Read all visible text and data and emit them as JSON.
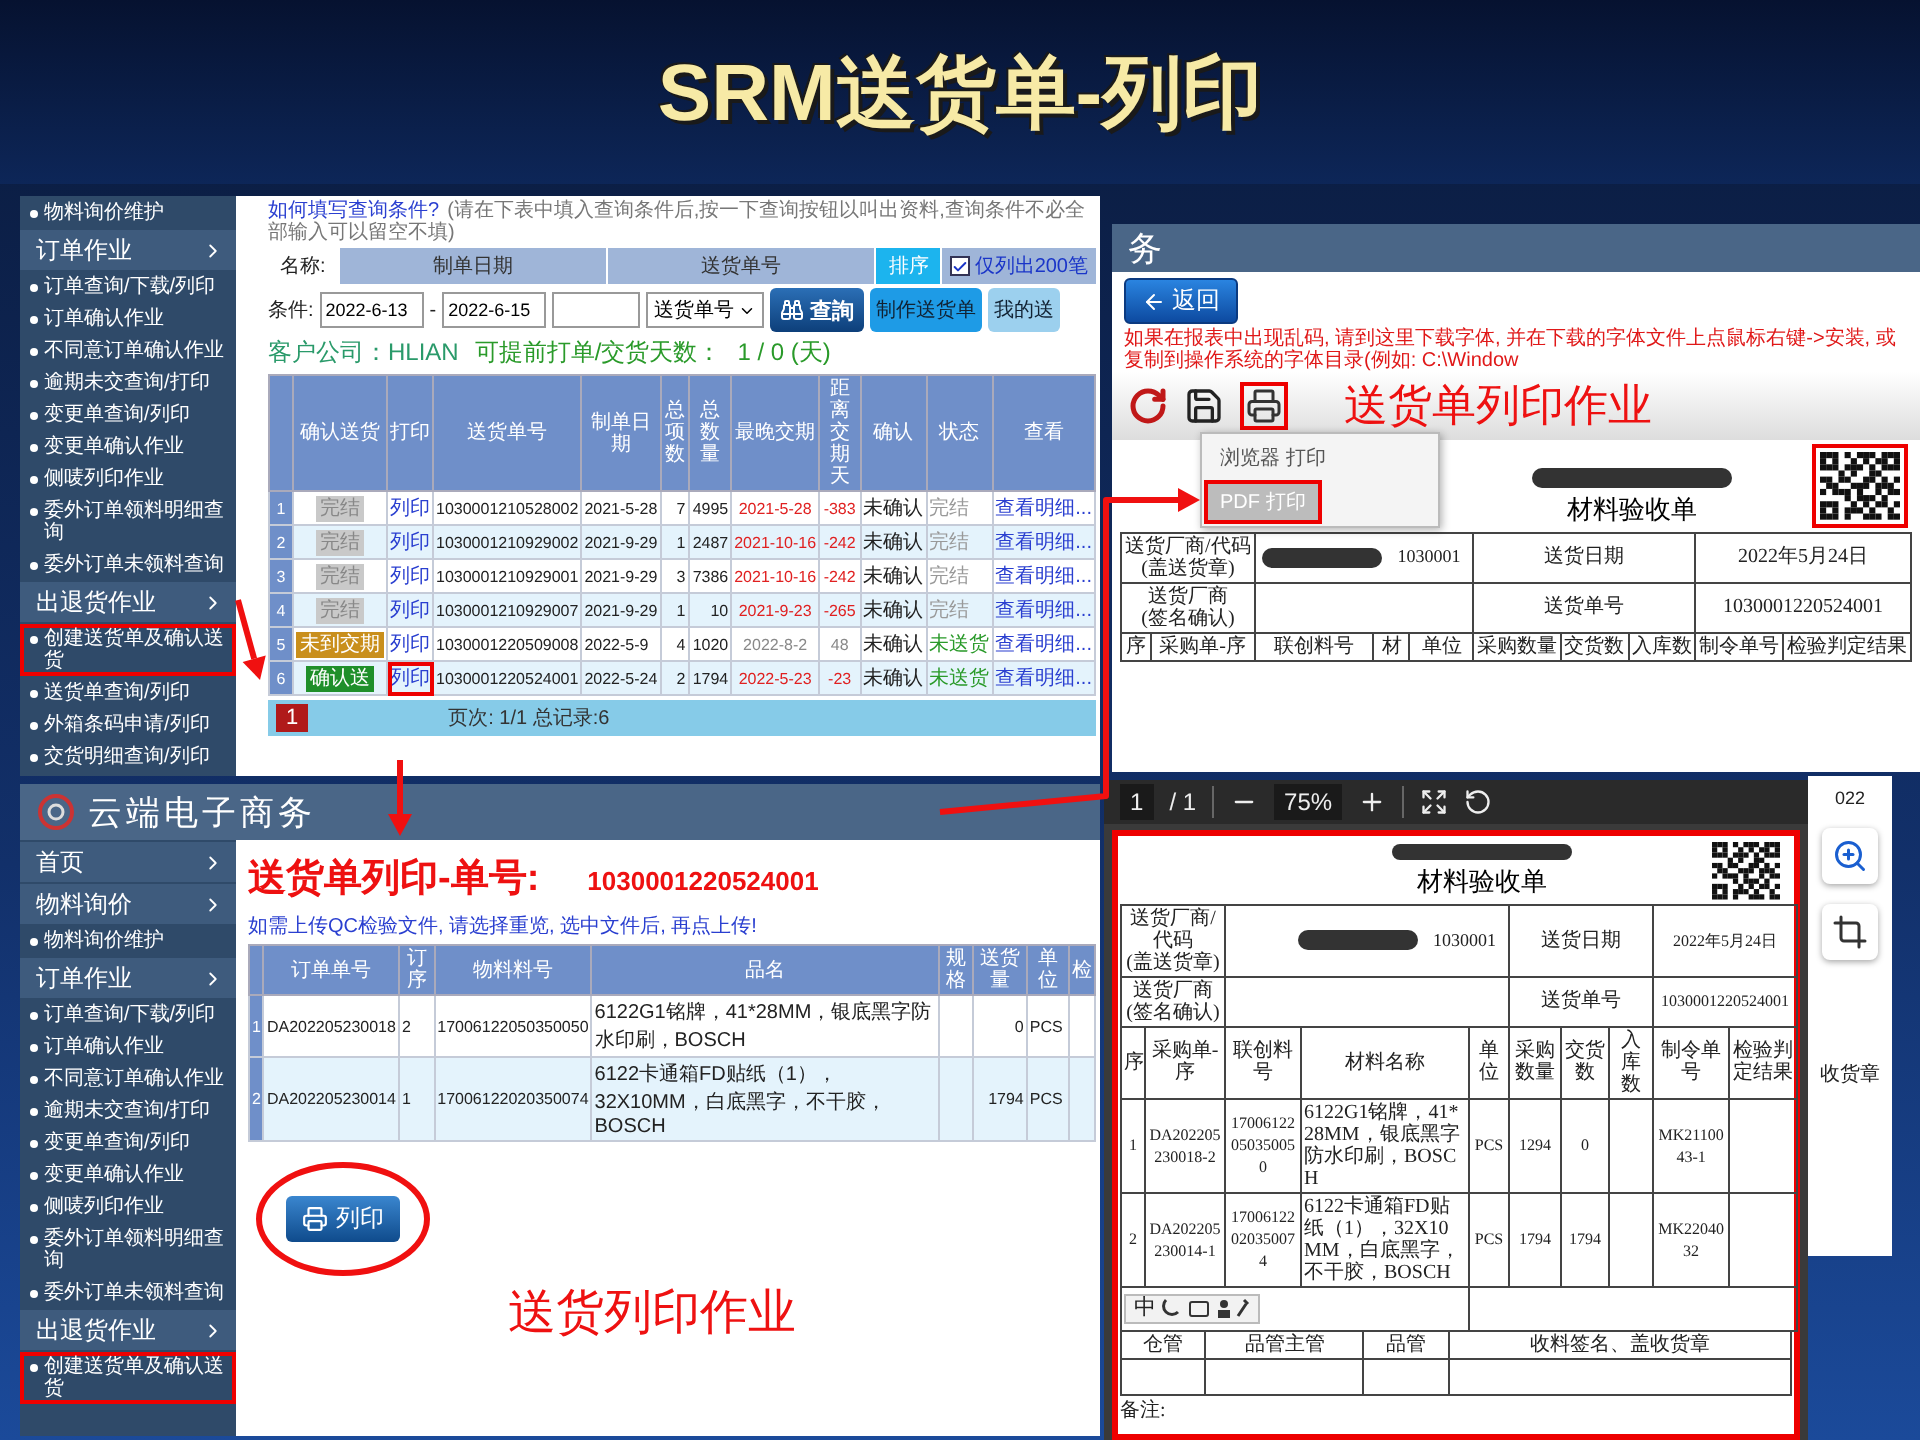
{
  "slide_title": "SRM送货单-列印",
  "list_window": {
    "sidebar": [
      {
        "kind": "item",
        "label": "物料询价维护",
        "highlighted": false
      },
      {
        "kind": "section",
        "label": "订单作业",
        "highlighted": false
      },
      {
        "kind": "item",
        "label": "订单查询/下载/列印",
        "highlighted": false
      },
      {
        "kind": "item",
        "label": "订单确认作业",
        "highlighted": false
      },
      {
        "kind": "item",
        "label": "不同意订单确认作业",
        "highlighted": false
      },
      {
        "kind": "item",
        "label": "逾期未交查询/打印",
        "highlighted": false
      },
      {
        "kind": "item",
        "label": "变更单查询/列印",
        "highlighted": false
      },
      {
        "kind": "item",
        "label": "变更单确认作业",
        "highlighted": false
      },
      {
        "kind": "item",
        "label": "侧唛列印作业",
        "highlighted": false
      },
      {
        "kind": "item",
        "label": "委外订单领料明细查询",
        "highlighted": false
      },
      {
        "kind": "item",
        "label": "委外订单未领料查询",
        "highlighted": false
      },
      {
        "kind": "section",
        "label": "出退货作业",
        "highlighted": false
      },
      {
        "kind": "item",
        "label": "创建送货单及确认送货",
        "highlighted": true
      },
      {
        "kind": "item",
        "label": "送货单查询/列印",
        "highlighted": false
      },
      {
        "kind": "item",
        "label": "外箱条码申请/列印",
        "highlighted": false
      },
      {
        "kind": "item",
        "label": "交货明细查询/列印",
        "highlighted": false
      }
    ],
    "help_link": "如何填写查询条件?",
    "help_text": "(请在下表中填入查询条件后,按一下查询按钮以叫出资料,查询条件不必全部输入可以留空不填)",
    "filter_headers": [
      {
        "kind": "caption",
        "label": "名称:"
      },
      {
        "kind": "header",
        "label": "制单日期"
      },
      {
        "kind": "header",
        "label": "送货单号"
      },
      {
        "kind": "sort",
        "label": "排序"
      }
    ],
    "limit_checkbox": {
      "label": "仅列出200笔",
      "checked": true
    },
    "condition_label": "条件:",
    "date_from": "2022-6-13",
    "date_sep": "-",
    "date_to": "2022-6-15",
    "sort_select": "送货单号",
    "query_button": "查詢",
    "buttons": [
      "制作送货单",
      "我的送"
    ],
    "company": "客户公司：HLIAN",
    "days_label": "可提前打单/交货天数：",
    "days_value": "1 / 0 (天)",
    "columns": [
      "",
      "确认送货",
      "打印",
      "送货单号",
      "制单日期",
      "总项数",
      "总数量",
      "最晚交期",
      "距离交期天",
      "确认",
      "状态",
      "查看"
    ],
    "rows": [
      {
        "index": "1",
        "action": {
          "label": "完结",
          "kind": "done"
        },
        "print": "列印",
        "print_highlighted": false,
        "number": "1030001210528002",
        "date": "2021-5-28",
        "items": "7",
        "qty": "4995",
        "due": "2021-5-28",
        "overdue": true,
        "days": "-383",
        "confirm": "未确认",
        "status": {
          "label": "完结",
          "kind": "done"
        },
        "view": "查看明细..."
      },
      {
        "index": "2",
        "action": {
          "label": "完结",
          "kind": "done"
        },
        "print": "列印",
        "print_highlighted": false,
        "number": "1030001210929002",
        "date": "2021-9-29",
        "items": "1",
        "qty": "2487",
        "due": "2021-10-16",
        "overdue": true,
        "days": "-242",
        "confirm": "未确认",
        "status": {
          "label": "完结",
          "kind": "done"
        },
        "view": "查看明细..."
      },
      {
        "index": "3",
        "action": {
          "label": "完结",
          "kind": "done"
        },
        "print": "列印",
        "print_highlighted": false,
        "number": "1030001210929001",
        "date": "2021-9-29",
        "items": "3",
        "qty": "7386",
        "due": "2021-10-16",
        "overdue": true,
        "days": "-242",
        "confirm": "未确认",
        "status": {
          "label": "完结",
          "kind": "done"
        },
        "view": "查看明细..."
      },
      {
        "index": "4",
        "action": {
          "label": "完结",
          "kind": "done"
        },
        "print": "列印",
        "print_highlighted": false,
        "number": "1030001210929007",
        "date": "2021-9-29",
        "items": "1",
        "qty": "10",
        "due": "2021-9-23",
        "overdue": true,
        "days": "-265",
        "confirm": "未确认",
        "status": {
          "label": "完结",
          "kind": "done"
        },
        "view": "查看明细..."
      },
      {
        "index": "5",
        "action": {
          "label": "未到交期",
          "kind": "pending"
        },
        "print": "列印",
        "print_highlighted": false,
        "number": "1030001220509008",
        "date": "2022-5-9",
        "items": "4",
        "qty": "1020",
        "due": "2022-8-2",
        "overdue": false,
        "days": "48",
        "confirm": "未确认",
        "status": {
          "label": "未送货",
          "kind": "pending"
        },
        "view": "查看明细..."
      },
      {
        "index": "6",
        "action": {
          "label": "确认送",
          "kind": "confirm"
        },
        "print": "列印",
        "print_highlighted": true,
        "number": "1030001220524001",
        "date": "2022-5-24",
        "items": "2",
        "qty": "1794",
        "due": "2022-5-23",
        "overdue": true,
        "days": "-23",
        "confirm": "未确认",
        "status": {
          "label": "未送货",
          "kind": "pending"
        },
        "view": "查看明细..."
      }
    ],
    "pager": {
      "page": "1",
      "text": "页次: 1/1 总记录:6"
    }
  },
  "print_window": {
    "brand": "云端电子商务",
    "sidebar": [
      {
        "kind": "section",
        "label": "首页",
        "highlighted": false
      },
      {
        "kind": "section",
        "label": "物料询价",
        "highlighted": false
      },
      {
        "kind": "item",
        "label": "物料询价维护",
        "highlighted": false
      },
      {
        "kind": "section",
        "label": "订单作业",
        "highlighted": false
      },
      {
        "kind": "item",
        "label": "订单查询/下载/列印",
        "highlighted": false
      },
      {
        "kind": "item",
        "label": "订单确认作业",
        "highlighted": false
      },
      {
        "kind": "item",
        "label": "不同意订单确认作业",
        "highlighted": false
      },
      {
        "kind": "item",
        "label": "逾期未交查询/打印",
        "highlighted": false
      },
      {
        "kind": "item",
        "label": "变更单查询/列印",
        "highlighted": false
      },
      {
        "kind": "item",
        "label": "变更单确认作业",
        "highlighted": false
      },
      {
        "kind": "item",
        "label": "侧唛列印作业",
        "highlighted": false
      },
      {
        "kind": "item",
        "label": "委外订单领料明细查询",
        "highlighted": false
      },
      {
        "kind": "item",
        "label": "委外订单未领料查询",
        "highlighted": false
      },
      {
        "kind": "section",
        "label": "出退货作业",
        "highlighted": false
      },
      {
        "kind": "item",
        "label": "创建送货单及确认送货",
        "highlighted": true
      }
    ],
    "heading": "送货单列印-单号:",
    "number": "1030001220524001",
    "notice": "如需上传QC检验文件, 请选择重览, 选中文件后, 再点上传!",
    "columns": [
      "",
      "订单单号",
      "订序",
      "物料料号",
      "品名",
      "规格",
      "送货量",
      "单位",
      "检"
    ],
    "rows": [
      {
        "index": "1",
        "order": "DA202205230018",
        "seq": "2",
        "part": "17006122050350050",
        "name": "6122G1铭牌，41*28MM，银底黑字防水印刷，BOSCH",
        "qty": "0",
        "unit": "PCS"
      },
      {
        "index": "2",
        "order": "DA202205230014",
        "seq": "1",
        "part": "17006122020350074",
        "name": "6122卡通箱FD贴纸（1），32X10MM，白底黑字，不干胶，BOSCH",
        "qty": "1794",
        "unit": "PCS"
      }
    ],
    "print_button": "列印",
    "annotation": "送货列印作业"
  },
  "report_window": {
    "header": "务",
    "back_button": "返回",
    "warning": "如果在报表中出现乱码, 请到这里下载字体, 并在下载的字体文件上点鼠标右键->安装, 或复制到操作系统的字体目录(例如: C:\\Window",
    "print_menu": [
      {
        "label": "浏览器 打印",
        "selected": false
      },
      {
        "label": "PDF 打印",
        "selected": true
      }
    ],
    "annotation": "送货单列印作业",
    "doc_title": "材料验收单",
    "info": [
      {
        "label": "送货厂商/代码",
        "sublabel": "(盖送货章)",
        "redacted": true,
        "value": "1030001",
        "label2": "送货日期",
        "value2": "2022年5月24日"
      },
      {
        "label": "送货厂商",
        "sublabel": "(签名确认)",
        "redacted": false,
        "label2": "送货单号",
        "value2": "1030001220524001"
      }
    ],
    "columns": [
      "序",
      "采购单-序",
      "联创料号",
      "材",
      "单位",
      "采购数量",
      "交货数",
      "入库数",
      "制令单号",
      "检验判定结果"
    ]
  },
  "pdf_viewer": {
    "page": "1",
    "page_total": "/ 1",
    "zoom": "75%",
    "doc_title": "材料验收单",
    "info": [
      {
        "label": "送货厂商/代码",
        "sublabel": "(盖送货章)",
        "redacted": true,
        "value": "1030001",
        "label2": "送货日期",
        "value2": "2022年5月24日"
      },
      {
        "label": "送货厂商",
        "sublabel": "(签名确认)",
        "redacted": false,
        "label2": "送货单号",
        "value2": "1030001220524001"
      }
    ],
    "columns": [
      "序",
      "采购单-序",
      "联创料号",
      "材料名称",
      "单位",
      "采购数量",
      "交货数",
      "入库数",
      "制令单号",
      "检验判定结果"
    ],
    "rows": [
      {
        "index": "1",
        "po": "DA202205230018-2",
        "part": "17006122050350050",
        "name": "6122G1铭牌，41*28MM，银底黑字防水印刷，BOSCH",
        "unit": "PCS",
        "po_qty": "1294",
        "delivered": "0",
        "order": "MK2110043-1"
      },
      {
        "index": "2",
        "po": "DA202205230014-1",
        "part": "17006122020350074",
        "name": "6122卡通箱FD贴纸（1），32X10MM，白底黑字，不干胶，BOSCH",
        "unit": "PCS",
        "po_qty": "1794",
        "delivered": "1794",
        "order": "MK2204032"
      }
    ],
    "ime_label": "中",
    "signatures": [
      "仓管",
      "品管主管",
      "品管",
      "收料签名、盖收货章"
    ],
    "remark": "备注:"
  },
  "side_strip": {
    "text_1": "022",
    "text_2": "收货章"
  }
}
